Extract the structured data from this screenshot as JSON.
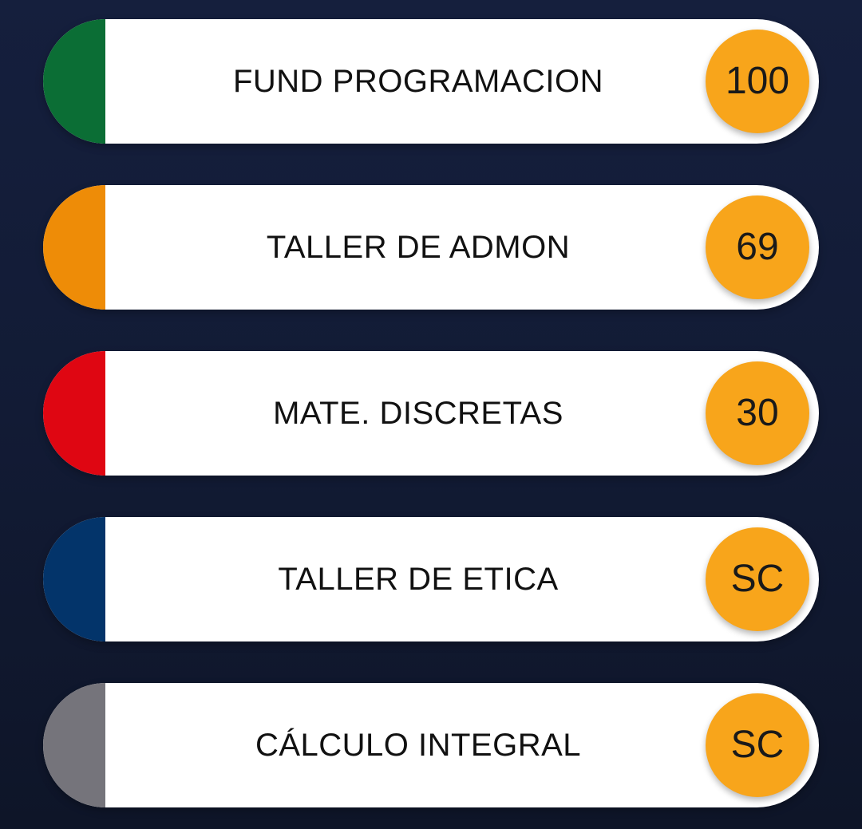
{
  "subjects": [
    {
      "name": "FUND PROGRAMACION",
      "grade": "100",
      "color": "#0b6e35"
    },
    {
      "name": "TALLER DE ADMON",
      "grade": "69",
      "color": "#ee8c07"
    },
    {
      "name": "MATE. DISCRETAS",
      "grade": "30",
      "color": "#df0612"
    },
    {
      "name": "TALLER DE ETICA",
      "grade": "SC",
      "color": "#03346a"
    },
    {
      "name": "CÁLCULO INTEGRAL",
      "grade": "SC",
      "color": "#75747b"
    }
  ],
  "colors": {
    "background": "#131c37",
    "card": "#ffffff",
    "grade_badge": "#f8a51b"
  }
}
